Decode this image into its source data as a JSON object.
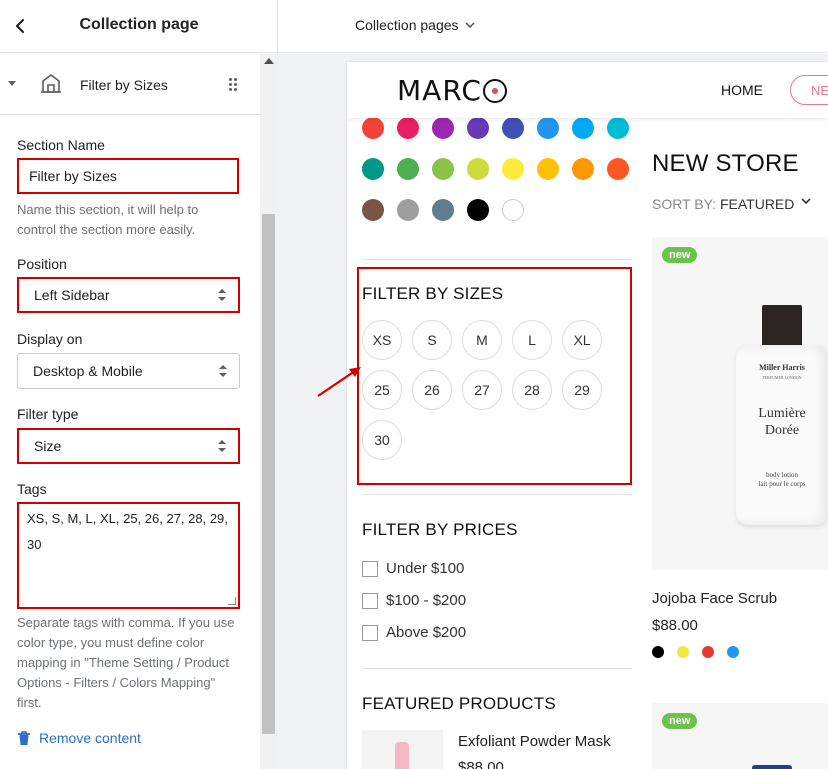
{
  "panel": {
    "title": "Collection page",
    "section_label": "Filter by Sizes",
    "section_name_label": "Section Name",
    "section_name_value": "Filter by Sizes",
    "section_name_help": "Name this section, it will help to control the section more easily.",
    "position_label": "Position",
    "position_value": "Left Sidebar",
    "display_label": "Display on",
    "display_value": "Desktop & Mobile",
    "filter_type_label": "Filter type",
    "filter_type_value": "Size",
    "tags_label": "Tags",
    "tags_value": "XS, S, M, L, XL, 25, 26, 27, 28, 29, 30",
    "tags_help": "Separate tags with comma. If you use color type, you must define color mapping in \"Theme Setting / Product Options - Filters / Colors Mapping\" first.",
    "remove_label": "Remove content"
  },
  "topbar": {
    "page_selector": "Collection pages"
  },
  "store": {
    "logo_text_1": "MARC",
    "nav_home": "HOME",
    "nav_pill": "NE",
    "swatch_colors": [
      [
        "#f44336",
        "#e91e63",
        "#9c27b0",
        "#673ab7",
        "#3f51b5",
        "#2196f3",
        "#03a9f4",
        "#00bcd4"
      ],
      [
        "#009688",
        "#4caf50",
        "#8bc34a",
        "#cddc39",
        "#ffeb3b",
        "#ffc107",
        "#ff9800",
        "#ff5722"
      ],
      [
        "#795548",
        "#9e9e9e",
        "#607d8b",
        "#000000",
        "#ffffff"
      ]
    ],
    "filter_sizes_title": "FILTER BY SIZES",
    "sizes": [
      "XS",
      "S",
      "M",
      "L",
      "XL",
      "25",
      "26",
      "27",
      "28",
      "29",
      "30"
    ],
    "filter_prices_title": "FILTER BY PRICES",
    "prices": [
      "Under $100",
      "$100 - $200",
      "Above $200"
    ],
    "featured_title": "FEATURED PRODUCTS",
    "featured_product_name": "Exfoliant Powder Mask",
    "featured_product_price": "$88.00",
    "title": "NEW STORE",
    "sort_prefix": "SORT BY: ",
    "sort_value": "FEATURED",
    "badge": "new",
    "bottle_brand": "Miller Harris",
    "bottle_sub": "PERFUMER LONDON",
    "bottle_name_1": "Lumière",
    "bottle_name_2": "Dorée",
    "bottle_desc_1": "body lotion",
    "bottle_desc_2": "lait pour le corps",
    "product_name": "Jojoba Face Scrub",
    "product_price": "$88.00",
    "product_colors": [
      "#000000",
      "#f4e542",
      "#e53935",
      "#2196f3"
    ]
  },
  "colors": {
    "highlight": "#d40000",
    "link": "#2c6ecb",
    "badge": "#6cc24a"
  }
}
